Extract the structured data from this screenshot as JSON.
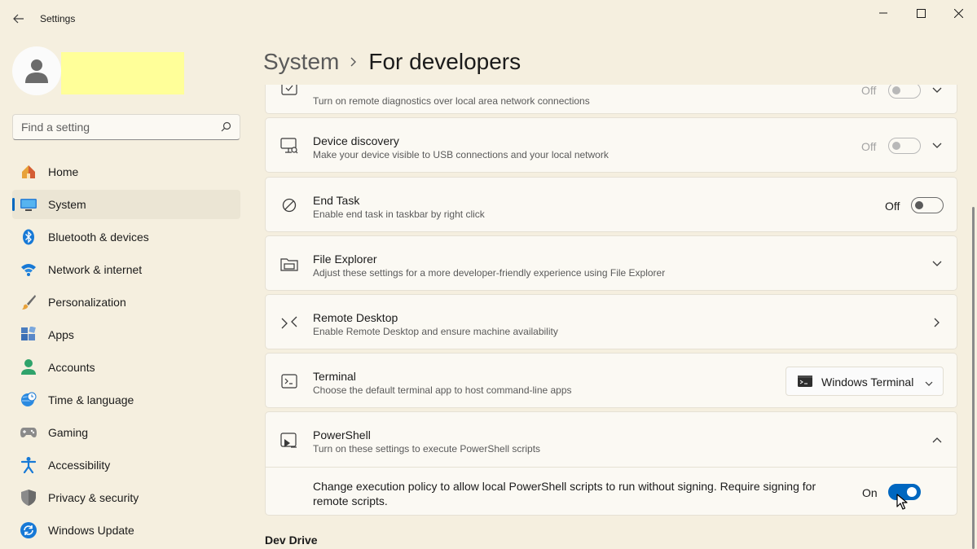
{
  "window": {
    "title": "Settings",
    "back_icon": "back-arrow-icon",
    "min_icon": "minimize-icon",
    "max_icon": "maximize-icon",
    "close_icon": "close-icon"
  },
  "sidebar": {
    "search_placeholder": "Find a setting",
    "items": [
      {
        "label": "Home",
        "icon": "home-icon"
      },
      {
        "label": "System",
        "icon": "system-icon",
        "active": true
      },
      {
        "label": "Bluetooth & devices",
        "icon": "bluetooth-icon"
      },
      {
        "label": "Network & internet",
        "icon": "wifi-icon"
      },
      {
        "label": "Personalization",
        "icon": "brush-icon"
      },
      {
        "label": "Apps",
        "icon": "apps-icon"
      },
      {
        "label": "Accounts",
        "icon": "accounts-icon"
      },
      {
        "label": "Time & language",
        "icon": "globe-clock-icon"
      },
      {
        "label": "Gaming",
        "icon": "gamepad-icon"
      },
      {
        "label": "Accessibility",
        "icon": "accessibility-icon"
      },
      {
        "label": "Privacy & security",
        "icon": "shield-icon"
      },
      {
        "label": "Windows Update",
        "icon": "update-icon"
      }
    ]
  },
  "header": {
    "parent": "System",
    "current": "For developers"
  },
  "settings": {
    "remote_diagnostics": {
      "description": "Turn on remote diagnostics over local area network connections",
      "state": "Off"
    },
    "device_discovery": {
      "title": "Device discovery",
      "description": "Make your device visible to USB connections and your local network",
      "state": "Off"
    },
    "end_task": {
      "title": "End Task",
      "description": "Enable end task in taskbar by right click",
      "state": "Off"
    },
    "file_explorer": {
      "title": "File Explorer",
      "description": "Adjust these settings for a more developer-friendly experience using File Explorer"
    },
    "remote_desktop": {
      "title": "Remote Desktop",
      "description": "Enable Remote Desktop and ensure machine availability"
    },
    "terminal": {
      "title": "Terminal",
      "description": "Choose the default terminal app to host command-line apps",
      "selected": "Windows Terminal"
    },
    "powershell": {
      "title": "PowerShell",
      "description": "Turn on these settings to execute PowerShell scripts",
      "policy_text": "Change execution policy to allow local PowerShell scripts to run without signing. Require signing for remote scripts.",
      "policy_state": "On"
    }
  },
  "next_section": "Dev Drive",
  "colors": {
    "background": "#f5efdf",
    "card": "#fbf9f3",
    "accent": "#0067c0",
    "highlight": "#ffff99"
  }
}
